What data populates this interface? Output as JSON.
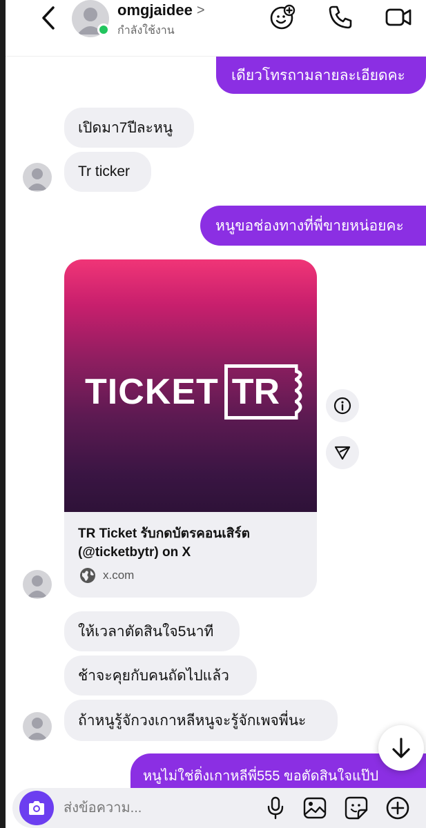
{
  "header": {
    "username": "omgjaidee",
    "chevron": ">",
    "status": "กำลังใช้งาน"
  },
  "messages": {
    "m1": "เดียวโทรถามลายละเอียดคะ",
    "m2": "เปิดมา7ปีละหนู",
    "m3": "Tr ticker",
    "m4": "หนูขอช่องทางที่พี่ขายหน่อยคะ",
    "m5": "ให้เวลาตัดสินใจ5นาที",
    "m6": "ช้าจะคุยกับคนถัดไปแล้ว",
    "m7": "ถ้าหนูรู้จักวงเกาหลีหนูจะรู้จักเพจพี่นะ",
    "m8": "หนูไม่ใช่ติ่งเกาหลีพี่555 ขอตัดสินใจแป๊ป"
  },
  "link_card": {
    "logo_word": "TICKET",
    "logo_box": "TR",
    "title": "TR Ticket รับกดบัตรคอนเสิร์ต (@ticketbytr) on X",
    "domain": "x.com"
  },
  "composer": {
    "placeholder": "ส่งข้อความ..."
  },
  "colors": {
    "outgoing_bubble": "#8b2fe3",
    "incoming_bubble": "#efeff3",
    "online": "#22c55e",
    "camera_button": "#6c3ef0"
  },
  "icons": [
    "back-arrow-icon",
    "chevron-right-icon",
    "sticker-add-icon",
    "phone-icon",
    "video-camera-icon",
    "info-icon",
    "share-icon",
    "globe-icon",
    "arrow-down-icon",
    "camera-icon",
    "microphone-icon",
    "gallery-icon",
    "sticker-icon",
    "plus-icon"
  ]
}
